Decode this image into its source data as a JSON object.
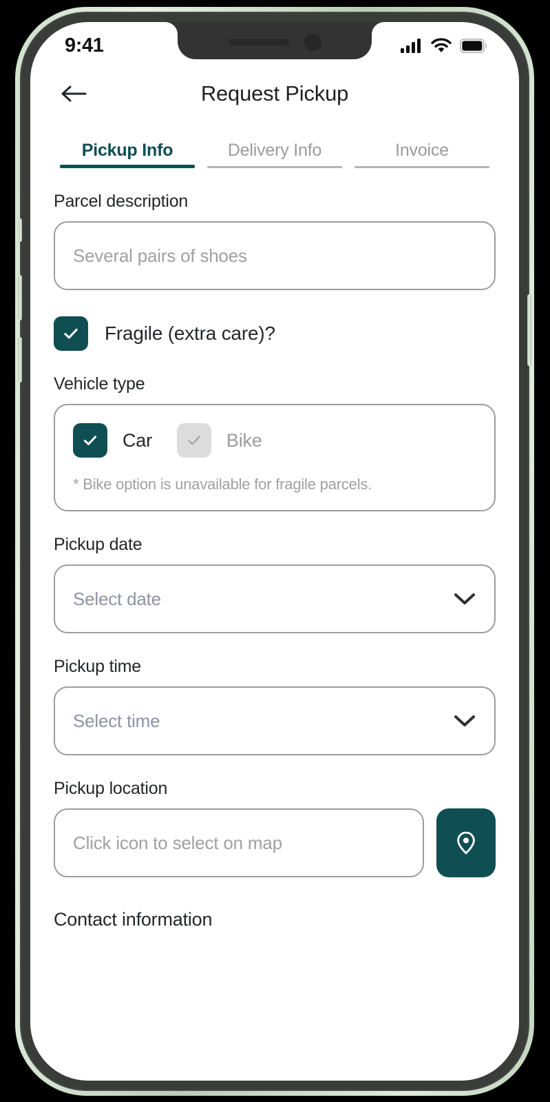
{
  "status_bar": {
    "time": "9:41",
    "signal_icon": "cellular-signal-icon",
    "wifi_icon": "wifi-icon",
    "battery_icon": "battery-full-icon"
  },
  "header": {
    "back_icon": "arrow-left-icon",
    "title": "Request Pickup"
  },
  "tabs": [
    {
      "label": "Pickup Info",
      "active": true
    },
    {
      "label": "Delivery Info",
      "active": false
    },
    {
      "label": "Invoice",
      "active": false
    }
  ],
  "form": {
    "parcel_description": {
      "label": "Parcel description",
      "placeholder": "Several pairs of shoes",
      "value": ""
    },
    "fragile": {
      "label": "Fragile (extra care)?",
      "checked": true
    },
    "vehicle": {
      "label": "Vehicle type",
      "options": [
        {
          "label": "Car",
          "checked": true,
          "disabled": false
        },
        {
          "label": "Bike",
          "checked": false,
          "disabled": true
        }
      ],
      "note": "* Bike option is unavailable for fragile parcels."
    },
    "pickup_date": {
      "label": "Pickup date",
      "placeholder": "Select date",
      "value": "",
      "chevron_icon": "chevron-down-icon"
    },
    "pickup_time": {
      "label": "Pickup time",
      "placeholder": "Select time",
      "value": "",
      "chevron_icon": "chevron-down-icon"
    },
    "pickup_location": {
      "label": "Pickup location",
      "placeholder": "Click icon to select on map",
      "value": "",
      "map_button_icon": "map-pin-icon"
    },
    "contact_section": {
      "label": "Contact information"
    }
  },
  "colors": {
    "accent": "#0F4E52",
    "border": "#9C9C9C",
    "muted_text": "#A0A0A0",
    "text": "#24262A",
    "disabled_fill": "#DCDCDC"
  }
}
